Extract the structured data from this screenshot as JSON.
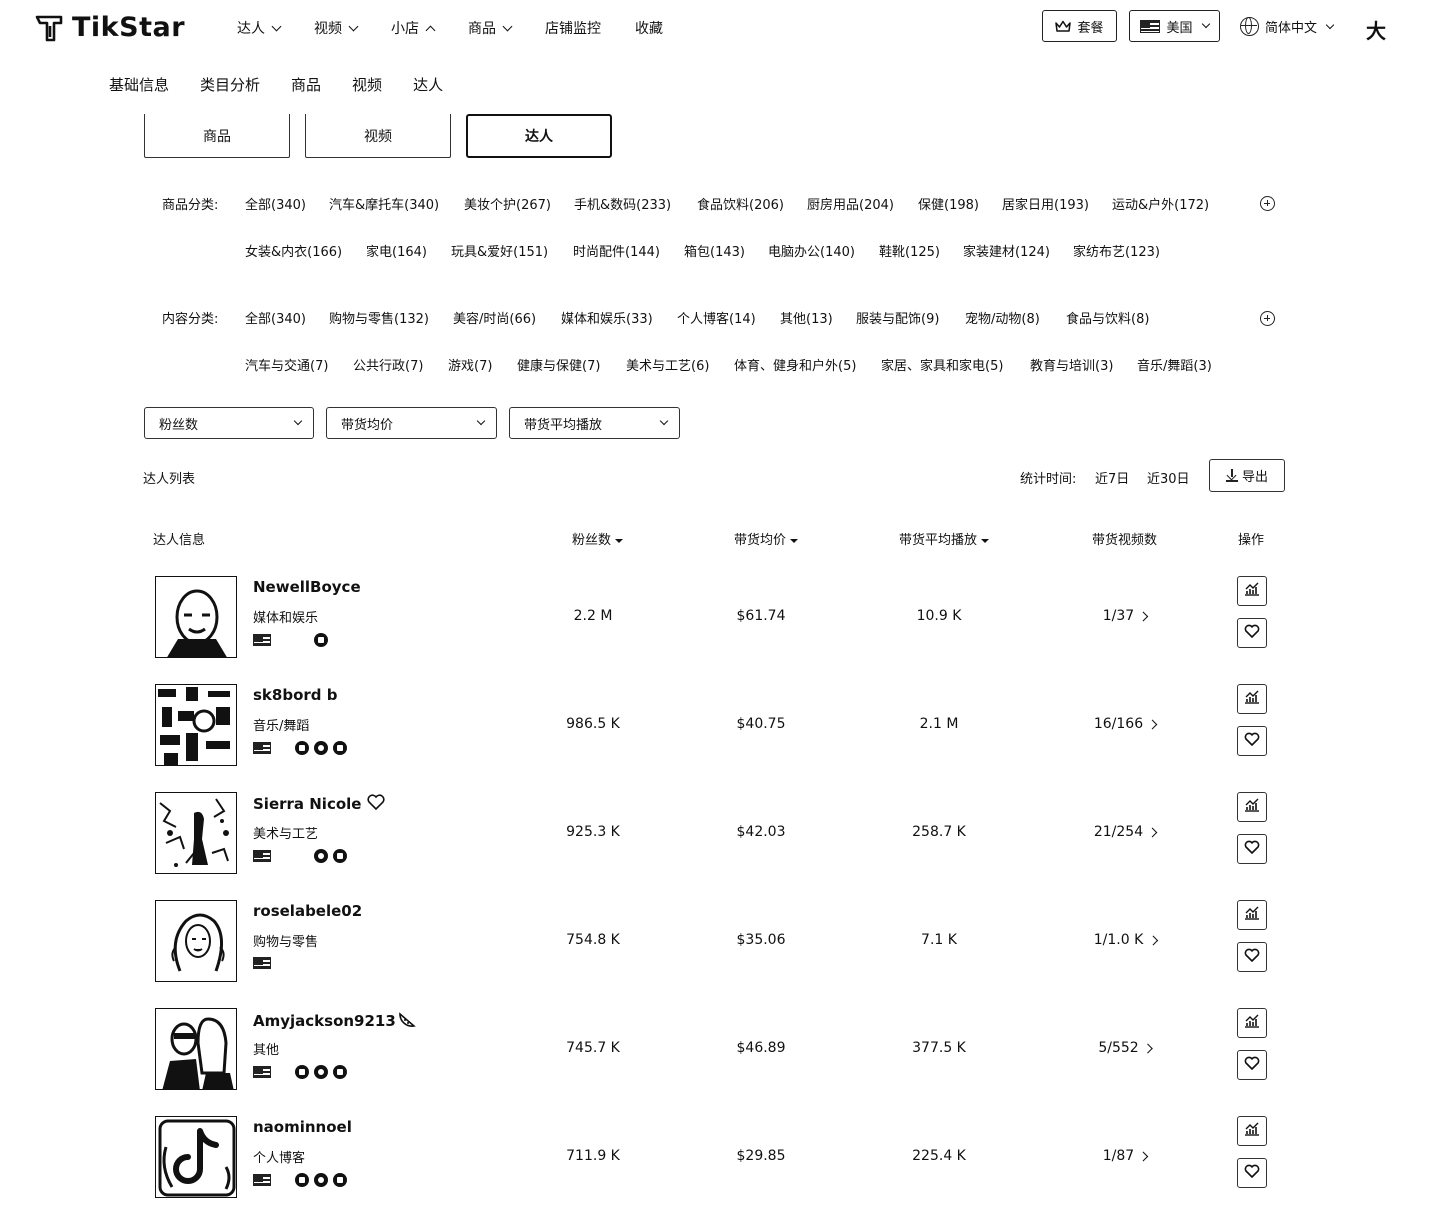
{
  "brand": {
    "name": "TikStar"
  },
  "topnav": [
    {
      "label": "达人",
      "chevron": "down"
    },
    {
      "label": "视频",
      "chevron": "down"
    },
    {
      "label": "小店",
      "chevron": "up"
    },
    {
      "label": "商品",
      "chevron": "down"
    },
    {
      "label": "店铺监控",
      "chevron": ""
    },
    {
      "label": "收藏",
      "chevron": ""
    }
  ],
  "header": {
    "plan_label": "套餐",
    "region_label": "美国",
    "language_label": "简体中文",
    "font_size_label": "大"
  },
  "subnav": [
    "基础信息",
    "类目分析",
    "商品",
    "视频",
    "达人"
  ],
  "segments": [
    {
      "label": "商品",
      "active": false
    },
    {
      "label": "视频",
      "active": false
    },
    {
      "label": "达人",
      "active": true
    }
  ],
  "product_category": {
    "label": "商品分类:",
    "row1": [
      "全部(340)",
      "汽车&摩托车(340)",
      "美妆个护(267)",
      "手机&数码(233)",
      "食品饮料(206)",
      "厨房用品(204)",
      "保健(198)",
      "居家日用(193)",
      "运动&户外(172)"
    ],
    "row2": [
      "女装&内衣(166)",
      "家电(164)",
      "玩具&爱好(151)",
      "时尚配件(144)",
      "箱包(143)",
      "电脑办公(140)",
      "鞋靴(125)",
      "家装建材(124)",
      "家纺布艺(123)"
    ]
  },
  "content_category": {
    "label": "内容分类:",
    "row1": [
      "全部(340)",
      "购物与零售(132)",
      "美容/时尚(66)",
      "媒体和娱乐(33)",
      "个人博客(14)",
      "其他(13)",
      "服装与配饰(9)",
      "宠物/动物(8)",
      "食品与饮料(8)"
    ],
    "row2": [
      "汽车与交通(7)",
      "公共行政(7)",
      "游戏(7)",
      "健康与保健(7)",
      "美术与工艺(6)",
      "体育、健身和户外(5)",
      "家居、家具和家电(5)",
      "教育与培训(3)",
      "音乐/舞蹈(3)"
    ]
  },
  "filters": [
    "粉丝数",
    "带货均价",
    "带货平均播放"
  ],
  "list": {
    "title": "达人列表",
    "stat_time_label": "统计时间:",
    "range_7": "近7日",
    "range_30": "近30日",
    "export_label": "导出"
  },
  "table": {
    "headers": [
      "达人信息",
      "粉丝数",
      "带货均价",
      "带货平均播放",
      "带货视频数",
      "操作"
    ],
    "rows": [
      {
        "name": "NewellBoyce",
        "category": "媒体和娱乐",
        "followers": "2.2 M",
        "avg_price": "$61.74",
        "avg_views": "10.9 K",
        "videos": "1/37",
        "socials": [
          "",
          "youtube"
        ],
        "badge": ""
      },
      {
        "name": "sk8bord b",
        "category": "音乐/舞蹈",
        "followers": "986.5 K",
        "avg_price": "$40.75",
        "avg_views": "2.1 M",
        "videos": "16/166",
        "socials": [
          "email",
          "instagram",
          "youtube"
        ],
        "badge": ""
      },
      {
        "name": "Sierra Nicole",
        "category": "美术与工艺",
        "followers": "925.3 K",
        "avg_price": "$42.03",
        "avg_views": "258.7 K",
        "videos": "21/254",
        "socials": [
          "",
          "instagram",
          "youtube"
        ],
        "badge": "heart"
      },
      {
        "name": "roselabele02",
        "category": "购物与零售",
        "followers": "754.8 K",
        "avg_price": "$35.06",
        "avg_views": "7.1 K",
        "videos": "1/1.0 K",
        "socials": [],
        "badge": ""
      },
      {
        "name": "Amyjackson9213",
        "category": "其他",
        "followers": "745.7 K",
        "avg_price": "$46.89",
        "avg_views": "377.5 K",
        "videos": "5/552",
        "socials": [
          "email",
          "instagram",
          "youtube"
        ],
        "badge": "watermelon"
      },
      {
        "name": "naominnoel",
        "category": "个人博客",
        "followers": "711.9 K",
        "avg_price": "$29.85",
        "avg_views": "225.4 K",
        "videos": "1/87",
        "socials": [
          "email",
          "instagram",
          "youtube"
        ],
        "badge": ""
      }
    ]
  }
}
